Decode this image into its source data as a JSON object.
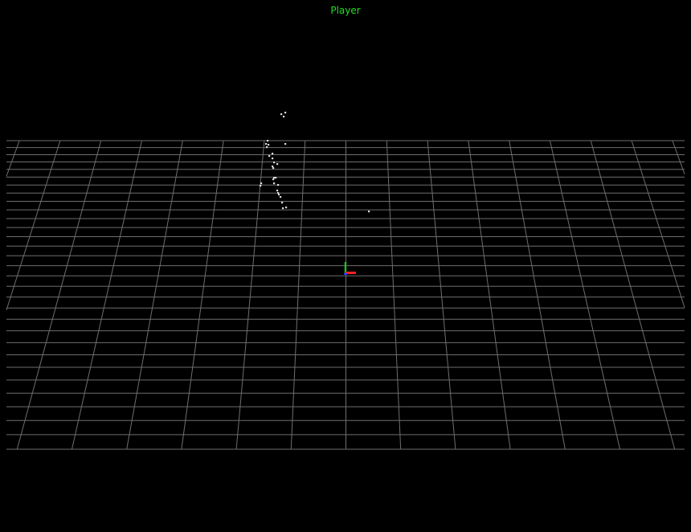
{
  "viewer": {
    "title": "Player",
    "title_color": "#22dd22",
    "background_color": "#000000",
    "grid_color": "#6e6e6e",
    "point_color": "#d8d8d8"
  },
  "axes_gizmo": {
    "x_axis_color": "#ff2020",
    "y_axis_color": "#20c020",
    "z_axis_color": "#3030ff"
  }
}
